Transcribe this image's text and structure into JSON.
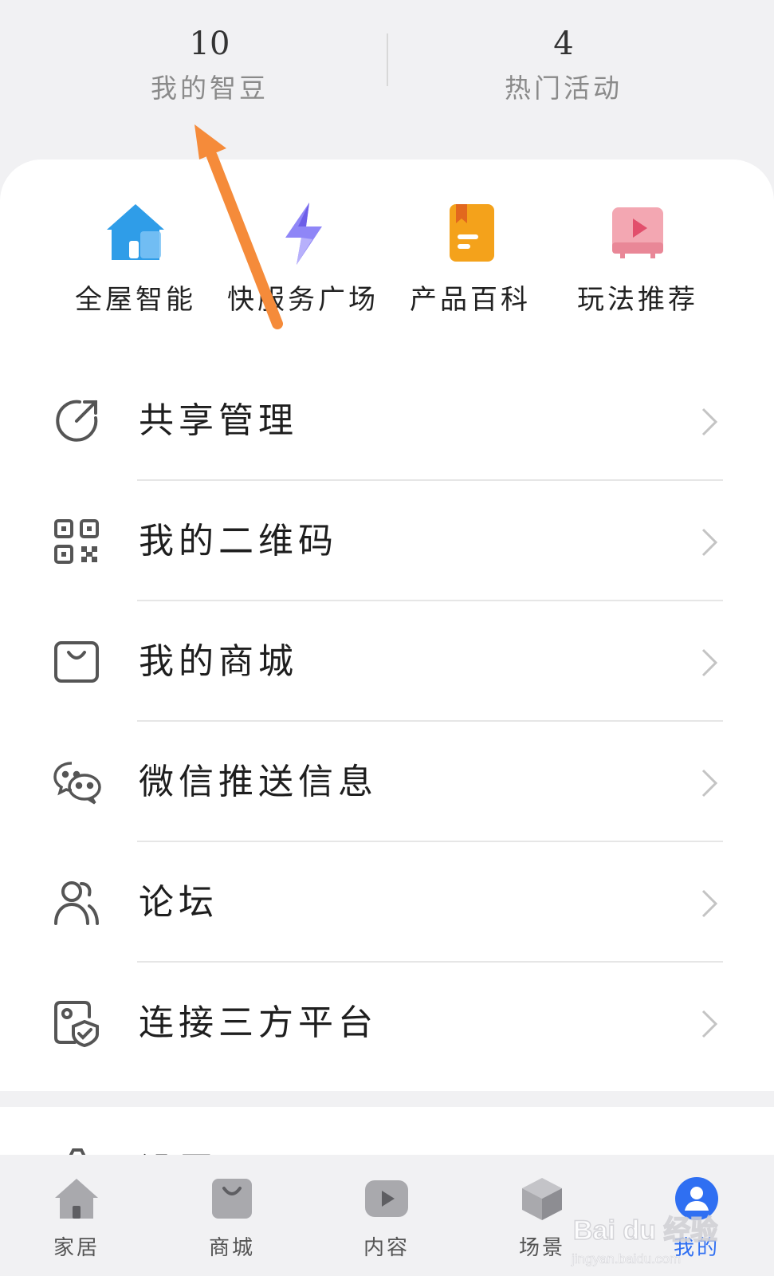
{
  "stats": [
    {
      "value": "10",
      "label": "我的智豆"
    },
    {
      "value": "4",
      "label": "热门活动"
    }
  ],
  "quick_actions": [
    {
      "label": "全屋智能",
      "icon": "house-icon",
      "color": "#2f9de8"
    },
    {
      "label": "快服务广场",
      "icon": "lightning-icon",
      "color": "#7b6cf0"
    },
    {
      "label": "产品百科",
      "icon": "book-icon",
      "color": "#f4a21b"
    },
    {
      "label": "玩法推荐",
      "icon": "video-play-icon",
      "color": "#e77f93"
    }
  ],
  "menu": [
    {
      "label": "共享管理",
      "icon": "share-icon"
    },
    {
      "label": "我的二维码",
      "icon": "qr-code-icon"
    },
    {
      "label": "我的商城",
      "icon": "shopping-bag-icon"
    },
    {
      "label": "微信推送信息",
      "icon": "wechat-icon"
    },
    {
      "label": "论坛",
      "icon": "forum-users-icon"
    },
    {
      "label": "连接三方平台",
      "icon": "third-party-shield-icon"
    }
  ],
  "partial_row": {
    "label": "设置",
    "icon": "settings-gear-icon"
  },
  "tabbar": [
    {
      "label": "家居",
      "icon": "home-icon",
      "active": false
    },
    {
      "label": "商城",
      "icon": "store-bag-icon",
      "active": false
    },
    {
      "label": "内容",
      "icon": "play-content-icon",
      "active": false
    },
    {
      "label": "场景",
      "icon": "cube-icon",
      "active": false
    },
    {
      "label": "我的",
      "icon": "profile-icon",
      "active": true
    }
  ],
  "watermark": {
    "brand": "Bai du 经验",
    "url": "jingyan.baidu.com"
  },
  "colors": {
    "accent": "#2f6ff2",
    "annotation_arrow": "#f58b3a",
    "background": "#f1f1f3"
  }
}
